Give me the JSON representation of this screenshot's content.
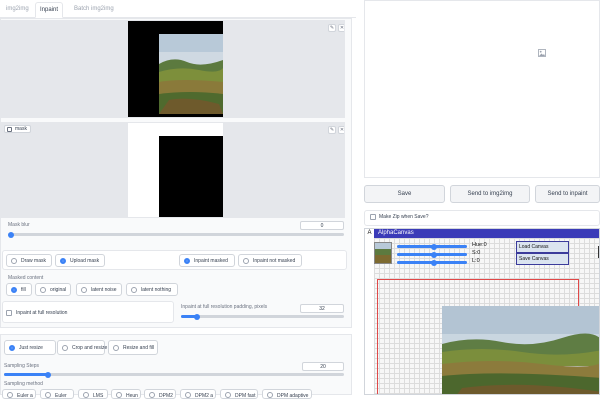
{
  "tabs": [
    "img2img",
    "Inpaint",
    "Batch img2img"
  ],
  "mask_label": "mask",
  "mask_blur": {
    "label": "Mask blur",
    "value": "0",
    "fraction": 0.0
  },
  "mask_mode": {
    "options": [
      "Draw mask",
      "Upload mask"
    ],
    "selected": "Upload mask"
  },
  "masked_mode": {
    "options": [
      "Inpaint masked",
      "Inpaint not masked"
    ],
    "selected": "Inpaint masked"
  },
  "masked_content": {
    "label": "Masked content",
    "options": [
      "fill",
      "original",
      "latent noise",
      "latent nothing"
    ],
    "selected": "fill"
  },
  "inpaint_full_res": {
    "label": "Inpaint at full resolution",
    "checked": false
  },
  "padding": {
    "label": "Inpaint at full resolution padding, pixels",
    "value": "32",
    "fraction": 0.1
  },
  "resize_mode": {
    "options": [
      "Just resize",
      "Crop and resize",
      "Resize and fill"
    ],
    "selected": "Just resize"
  },
  "sampling_steps": {
    "label": "Sampling Steps",
    "value": "20",
    "fraction": 0.13
  },
  "sampling_method": {
    "label": "Sampling method",
    "options": [
      "Euler a",
      "Euler",
      "LMS",
      "Heun",
      "DPM2",
      "DPM2 a",
      "DPM fast",
      "DPM adaptive"
    ]
  },
  "actions": {
    "save": "Save",
    "send_img2img": "Send to img2img",
    "send_inpaint": "Send to inpaint"
  },
  "make_zip": "Make Zip when Save?",
  "alpha_canvas": {
    "corner": "A",
    "title": "AlphaCanvas",
    "hue": "Hue:0",
    "sat": "S:0",
    "light": "L:0",
    "load": "Load Canvas",
    "save": "Save Canvas"
  },
  "colors": {
    "accent": "#3b82f6",
    "canvas_header": "#3b3bb8"
  },
  "icons": [
    "edit-icon",
    "close-icon",
    "image-placeholder-icon",
    "mask-icon"
  ]
}
